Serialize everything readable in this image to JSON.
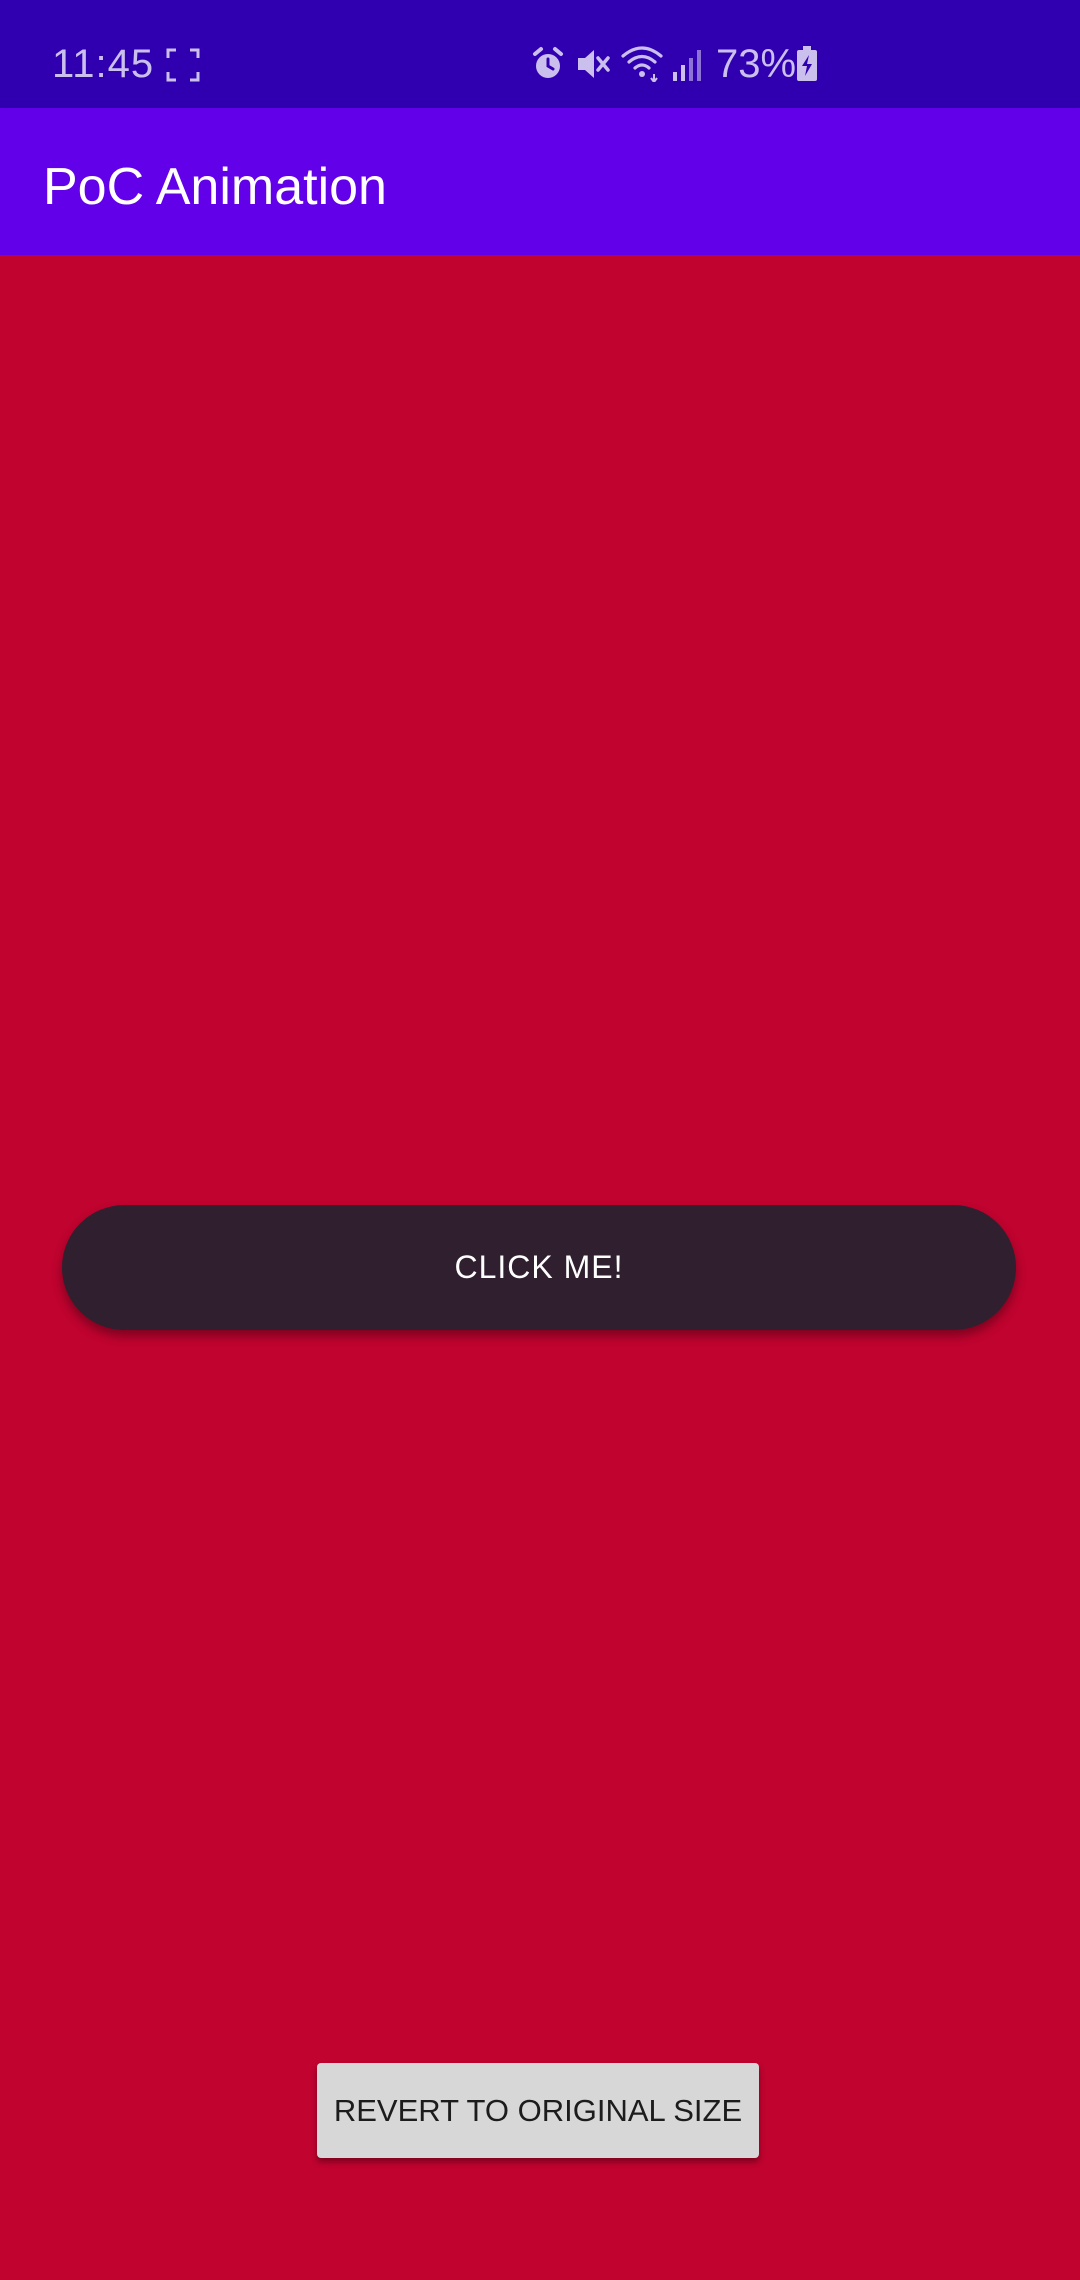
{
  "status_bar": {
    "time": "11:45",
    "battery_percent": "73%",
    "icons": [
      "screenshot-icon",
      "alarm-icon",
      "mute-icon",
      "wifi-icon",
      "signal-icon",
      "battery-charging-icon"
    ]
  },
  "app_bar": {
    "title": "PoC Animation"
  },
  "main": {
    "click_button_label": "CLICK ME!",
    "revert_button_label": "REVERT TO ORIGINAL SIZE"
  },
  "colors": {
    "status_bar": "#3000b0",
    "app_bar": "#6200ea",
    "background": "#c0032f",
    "click_button": "#2f1f2f",
    "revert_button": "#d7d7d7"
  }
}
